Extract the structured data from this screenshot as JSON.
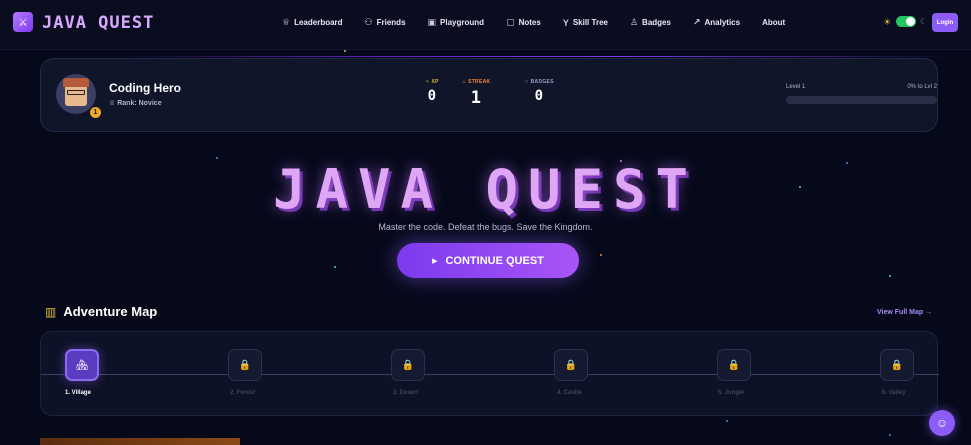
{
  "brand": {
    "name": "JAVA QUEST",
    "logo_icon": "sword-icon"
  },
  "nav": {
    "items": [
      {
        "label": "Leaderboard",
        "icon": "trophy-icon"
      },
      {
        "label": "Friends",
        "icon": "users-icon"
      },
      {
        "label": "Playground",
        "icon": "terminal-icon"
      },
      {
        "label": "Notes",
        "icon": "note-icon"
      },
      {
        "label": "Skill Tree",
        "icon": "branch-icon"
      },
      {
        "label": "Badges",
        "icon": "medal-icon"
      },
      {
        "label": "Analytics",
        "icon": "trend-icon"
      },
      {
        "label": "About",
        "icon": ""
      }
    ],
    "login_label": "Login",
    "theme_toggle_on": true
  },
  "profile": {
    "name": "Coding Hero",
    "rank": "Rank: Novice",
    "level_badge": "1",
    "stats": [
      {
        "label": "XP",
        "value": "0",
        "color": "#e2b93b"
      },
      {
        "label": "STREAK",
        "value": "1",
        "color": "#f28a3a"
      },
      {
        "label": "BADGES",
        "value": "0",
        "color": "#9aa0c4"
      }
    ],
    "level_label": "Level 1",
    "progress_label": "0% to Lvl 2",
    "progress_pct": 0
  },
  "hero": {
    "title": "JAVA QUEST",
    "tagline": "Master the code. Defeat the bugs. Save the Kingdom.",
    "cta_label": "CONTINUE QUEST"
  },
  "map": {
    "title": "Adventure Map",
    "view_full": "View Full Map →",
    "stages": [
      {
        "label": "1. Village",
        "active": true,
        "icon": "village-icon"
      },
      {
        "label": "2. Forest",
        "active": false,
        "icon": "lock-icon"
      },
      {
        "label": "3. Desert",
        "active": false,
        "icon": "lock-icon"
      },
      {
        "label": "4. Castle",
        "active": false,
        "icon": "lock-icon"
      },
      {
        "label": "5. Jungle",
        "active": false,
        "icon": "lock-icon"
      },
      {
        "label": "6. Valley",
        "active": false,
        "icon": "lock-icon"
      }
    ]
  },
  "colors": {
    "accent": "#8b5cf6",
    "background": "#06091a",
    "title": "#dea6f4"
  }
}
